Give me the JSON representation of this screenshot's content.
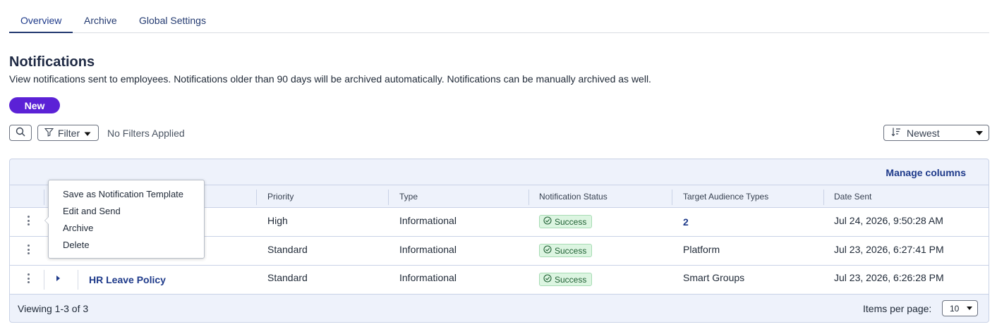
{
  "tabs": [
    {
      "label": "Overview",
      "active": true
    },
    {
      "label": "Archive",
      "active": false
    },
    {
      "label": "Global Settings",
      "active": false
    }
  ],
  "page": {
    "title": "Notifications",
    "description": "View notifications sent to employees. Notifications older than 90 days will be archived automatically. Notifications can be manually archived as well."
  },
  "toolbar": {
    "new_label": "New",
    "filter_label": "Filter",
    "filter_status": "No Filters Applied",
    "sort_label": "Newest"
  },
  "table": {
    "manage_columns": "Manage columns",
    "columns": [
      "Priority",
      "Type",
      "Notification Status",
      "Target Audience Types",
      "Date Sent"
    ],
    "rows": [
      {
        "name": "",
        "priority": "High",
        "type": "Informational",
        "status": "Success",
        "audience": "2",
        "date": "Jul 24, 2026, 9:50:28 AM"
      },
      {
        "name": "",
        "priority": "Standard",
        "type": "Informational",
        "status": "Success",
        "audience": "Platform",
        "date": "Jul 23, 2026, 6:27:41 PM"
      },
      {
        "name": "HR Leave Policy",
        "priority": "Standard",
        "type": "Informational",
        "status": "Success",
        "audience": "Smart Groups",
        "date": "Jul 23, 2026, 6:26:28 PM"
      }
    ],
    "footer": {
      "viewing": "Viewing 1-3 of 3",
      "items_per_page_label": "Items per page:",
      "items_per_page_value": "10"
    }
  },
  "context_menu": {
    "items": [
      "Save as Notification Template",
      "Edit and Send",
      "Archive",
      "Delete"
    ]
  },
  "colors": {
    "primary": "#5b21d6",
    "link": "#1e3a8a",
    "success_bg": "#dcf5e1"
  }
}
